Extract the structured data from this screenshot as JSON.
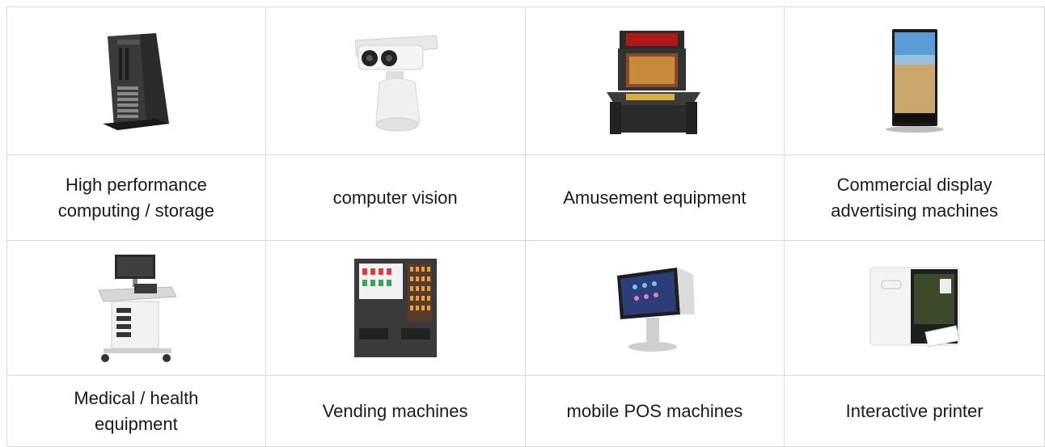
{
  "products": [
    {
      "label": "High performance computing / storage",
      "icon": "server-tower-icon"
    },
    {
      "label": "computer vision",
      "icon": "ptz-camera-icon"
    },
    {
      "label": "Amusement equipment",
      "icon": "arcade-cabinet-icon"
    },
    {
      "label": "Commercial display advertising machines",
      "icon": "digital-signage-icon"
    },
    {
      "label": "Medical / health equipment",
      "icon": "ultrasound-machine-icon"
    },
    {
      "label": "Vending machines",
      "icon": "vending-machine-icon"
    },
    {
      "label": "mobile POS machines",
      "icon": "pos-terminal-icon"
    },
    {
      "label": "Interactive printer",
      "icon": "photo-printer-icon"
    }
  ]
}
